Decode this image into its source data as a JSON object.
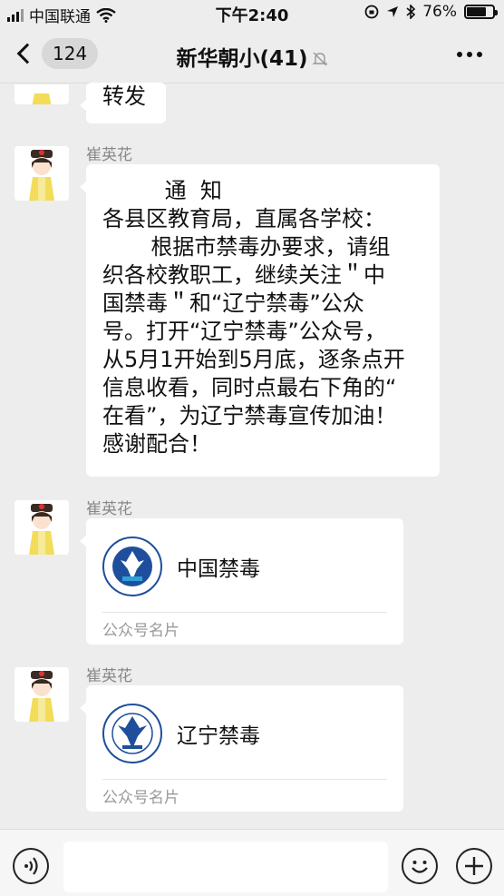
{
  "status_bar": {
    "carrier": "中国联通",
    "time": "下午2:40",
    "battery_percent": "76%",
    "battery_level": 0.76
  },
  "nav": {
    "unread_count": "124",
    "title": "新华朝小(41)"
  },
  "messages": [
    {
      "type": "text",
      "text": "转发"
    },
    {
      "type": "text",
      "sender": "崔英花",
      "lines": [
        "         通  知",
        "各县区教育局，直属各学校：",
        "       根据市禁毒办要求，请组",
        "织各校教职工，继续关注＂中",
        "国禁毒＂和“辽宁禁毒”公众",
        "号。打开“辽宁禁毒”公众号，",
        "从5月1开始到5月底，逐条点开",
        "信息收看，同时点最右下角的“",
        "在看”，为辽宁禁毒宣传加油！",
        "感谢配合！"
      ]
    },
    {
      "type": "card",
      "sender": "崔英花",
      "name": "中国禁毒",
      "card_type": "公众号名片"
    },
    {
      "type": "card",
      "sender": "崔英花",
      "name": "辽宁禁毒",
      "card_type": "公众号名片"
    }
  ],
  "colors": {
    "background": "#ededed",
    "bubble": "#ffffff",
    "sender_text": "#888888",
    "logo_blue": "#1f4f9c"
  },
  "icons": [
    "back-chevron-icon",
    "mute-bell-icon",
    "more-dots-icon",
    "wifi-icon",
    "location-icon",
    "bluetooth-icon",
    "voice-icon",
    "emoji-icon",
    "plus-icon"
  ]
}
